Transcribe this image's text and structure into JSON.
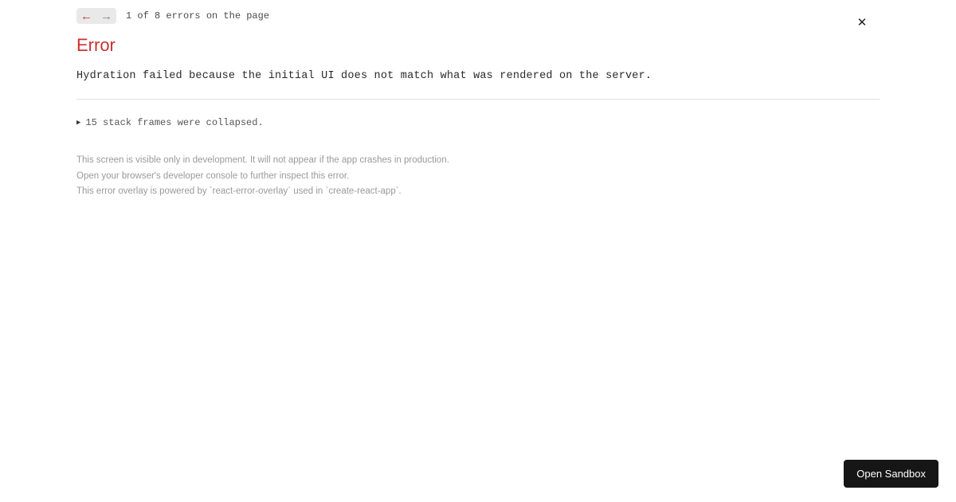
{
  "nav": {
    "prev_icon": "←",
    "next_icon": "→",
    "counter": "1 of 8 errors on the page"
  },
  "heading": "Error",
  "message": "Hydration failed because the initial UI does not match what was rendered on the server.",
  "collapsed": {
    "triangle": "▶",
    "text": "15 stack frames were collapsed."
  },
  "footer": {
    "line1": "This screen is visible only in development. It will not appear if the app crashes in production.",
    "line2": "Open your browser's developer console to further inspect this error.",
    "line3": "This error overlay is powered by `react-error-overlay` used in `create-react-app`."
  },
  "close_icon": "✕",
  "sandbox_button": "Open Sandbox"
}
